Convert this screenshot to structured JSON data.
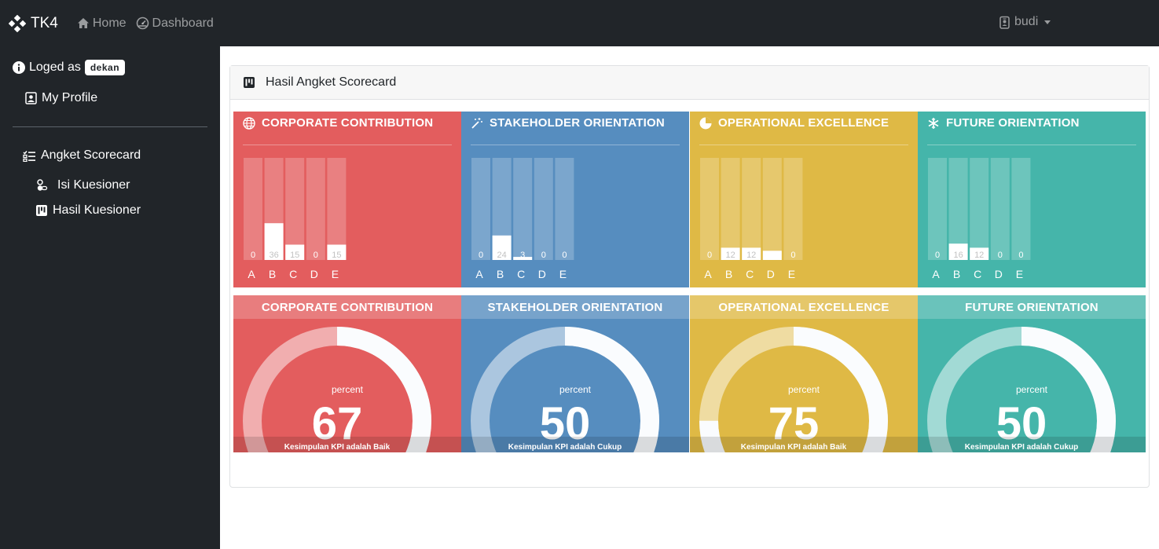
{
  "navbar": {
    "brand": "TK4",
    "home": "Home",
    "dashboard": "Dashboard",
    "user": "budi"
  },
  "sidebar": {
    "loged_as": "Loged as",
    "role": "dekan",
    "my_profile": "My Profile",
    "section": "Angket Scorecard",
    "items": [
      {
        "label": "Isi Kuesioner"
      },
      {
        "label": "Hasil Kuesioner"
      }
    ]
  },
  "card": {
    "title": "Hasil Angket Scorecard"
  },
  "colors": {
    "red": "#e35d5e",
    "blue": "#568dbf",
    "yellow": "#dfb945",
    "teal": "#45b5aa",
    "dark": "#212529"
  },
  "panels": [
    {
      "title": "CORPORATE CONTRIBUTION",
      "icon": "globe-icon",
      "color": "#e35d5e"
    },
    {
      "title": "STAKEHOLDER ORIENTATION",
      "icon": "magic-wand-icon",
      "color": "#568dbf"
    },
    {
      "title": "OPERATIONAL EXCELLENCE",
      "icon": "pie-chart-icon",
      "color": "#dfb945"
    },
    {
      "title": "FUTURE ORIENTATION",
      "icon": "snowflake-icon",
      "color": "#45b5aa"
    }
  ],
  "gauges": [
    {
      "title": "CORPORATE CONTRIBUTION",
      "percent_label": "percent",
      "value": 67,
      "caption": "Kesimpulan KPI adalah Baik",
      "color": "#e35d5e"
    },
    {
      "title": "STAKEHOLDER ORIENTATION",
      "percent_label": "percent",
      "value": 50,
      "caption": "Kesimpulan KPI adalah Cukup",
      "color": "#568dbf"
    },
    {
      "title": "OPERATIONAL EXCELLENCE",
      "percent_label": "percent",
      "value": 75,
      "caption": "Kesimpulan KPI adalah Baik",
      "color": "#dfb945"
    },
    {
      "title": "FUTURE ORIENTATION",
      "percent_label": "percent",
      "value": 50,
      "caption": "Kesimpulan KPI adalah Cukup",
      "color": "#45b5aa"
    }
  ],
  "chart_data": [
    {
      "type": "bar",
      "categories": [
        "A",
        "B",
        "C",
        "D",
        "E"
      ],
      "values": [
        0,
        36,
        15,
        0,
        15
      ],
      "ylim": [
        0,
        100
      ]
    },
    {
      "type": "bar",
      "categories": [
        "A",
        "B",
        "C",
        "D",
        "E"
      ],
      "values": [
        0,
        24,
        3,
        0,
        0
      ],
      "ylim": [
        0,
        100
      ]
    },
    {
      "type": "bar",
      "categories": [
        "A",
        "B",
        "C",
        "D",
        "E"
      ],
      "values": [
        0,
        12,
        12,
        9,
        0
      ],
      "ylim": [
        0,
        100
      ]
    },
    {
      "type": "bar",
      "categories": [
        "A",
        "B",
        "C",
        "D",
        "E"
      ],
      "values": [
        0,
        16,
        12,
        0,
        0
      ],
      "ylim": [
        0,
        100
      ]
    }
  ]
}
